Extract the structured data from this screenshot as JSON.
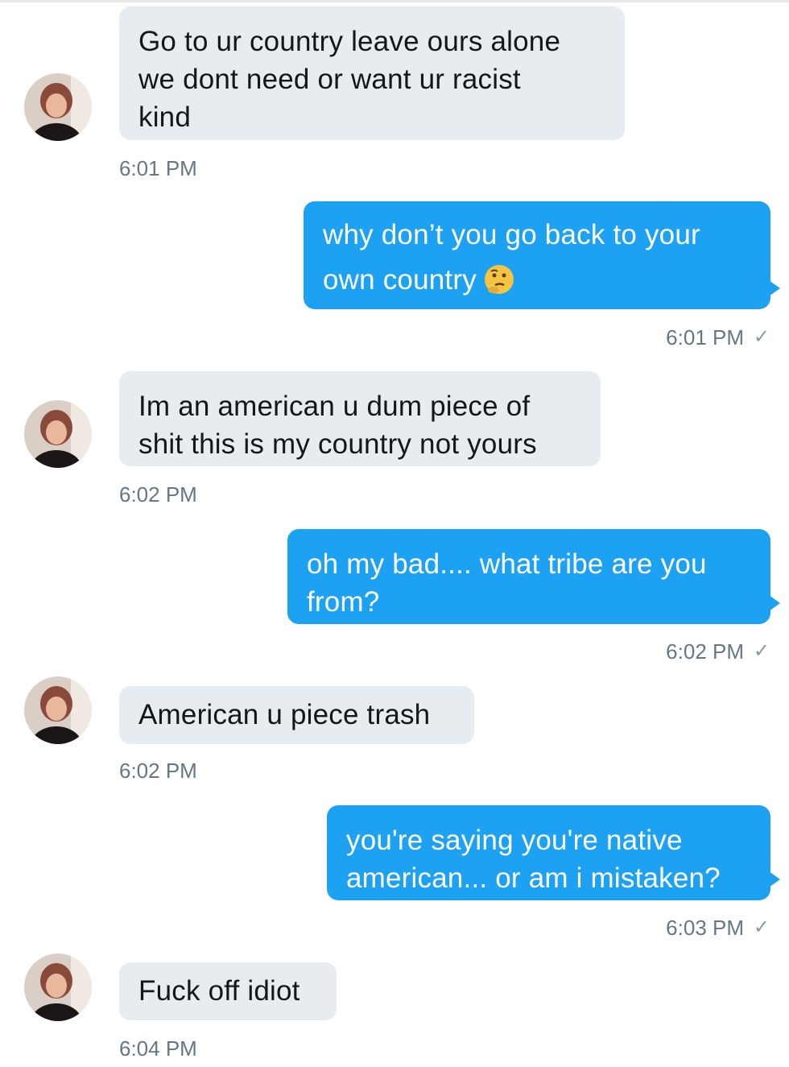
{
  "messages": [
    {
      "id": "m1",
      "direction": "incoming",
      "lines": [
        "Go to ur country leave ours alone",
        "we dont need or want ur racist",
        "kind"
      ],
      "time": "6:01 PM"
    },
    {
      "id": "m2",
      "direction": "outgoing",
      "lines": [
        "why don’t you go back to your",
        "own country"
      ],
      "emoji": "thinking-face",
      "time": "6:01 PM",
      "status": "✓"
    },
    {
      "id": "m3",
      "direction": "incoming",
      "lines": [
        "Im an american u dum piece of",
        "shit this is my country not yours"
      ],
      "time": "6:02 PM"
    },
    {
      "id": "m4",
      "direction": "outgoing",
      "lines": [
        "oh my bad.... what tribe are you",
        "from?"
      ],
      "time": "6:02 PM",
      "status": "✓"
    },
    {
      "id": "m5",
      "direction": "incoming",
      "lines": [
        "American u piece trash"
      ],
      "time": "6:02 PM"
    },
    {
      "id": "m6",
      "direction": "outgoing",
      "lines": [
        "you're saying you're native",
        "american... or am i mistaken?"
      ],
      "time": "6:03 PM",
      "status": "✓"
    },
    {
      "id": "m7",
      "direction": "incoming",
      "lines": [
        "Fuck off idiot"
      ],
      "time": "6:04 PM"
    }
  ],
  "colors": {
    "incoming_bubble": "#e6ecf0",
    "outgoing_bubble": "#1da1f2",
    "timestamp": "#657786"
  }
}
